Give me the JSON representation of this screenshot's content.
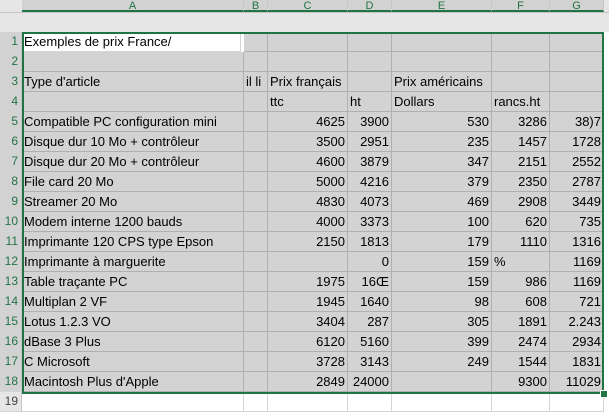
{
  "columns": [
    "A",
    "B",
    "C",
    "D",
    "E",
    "F",
    "G"
  ],
  "rows": [
    {
      "n": "1",
      "A": "Exemples de prix France/",
      "B": "",
      "C": "",
      "D": "",
      "E": "",
      "F": "",
      "G": ""
    },
    {
      "n": "2",
      "A": "",
      "B": "",
      "C": "",
      "D": "",
      "E": "",
      "F": "",
      "G": ""
    },
    {
      "n": "3",
      "A": "Type d'article",
      "B": "il li",
      "C": "Prix français",
      "D": "",
      "E": "Prix américains",
      "F": "",
      "G": ""
    },
    {
      "n": "4",
      "A": "",
      "B": "",
      "C": "ttc",
      "D": "ht",
      "E": "Dollars",
      "F": "rancs.ht",
      "G": ""
    },
    {
      "n": "5",
      "A": "Compatible PC configuration mini",
      "B": "",
      "C": "4625",
      "D": "3900",
      "E": "530",
      "F": "3286",
      "G": "38)7"
    },
    {
      "n": "6",
      "A": "Disque dur 10 Mo + contrôleur",
      "B": "",
      "C": "3500",
      "D": "2951",
      "E": "235",
      "F": "1457",
      "G": "1728"
    },
    {
      "n": "7",
      "A": "Disque dur 20 Mo + contrôleur",
      "B": "",
      "C": "4600",
      "D": "3879",
      "E": "347",
      "F": "2151",
      "G": "2552"
    },
    {
      "n": "8",
      "A": "File card 20 Mo",
      "B": "",
      "C": "5000",
      "D": "4216",
      "E": "379",
      "F": "2350",
      "G": "2787"
    },
    {
      "n": "9",
      "A": "Streamer 20 Mo",
      "B": "",
      "C": "4830",
      "D": "4073",
      "E": "469",
      "F": "2908",
      "G": "3449"
    },
    {
      "n": "10",
      "A": "Modem interne 1200 bauds",
      "B": "",
      "C": "4000",
      "D": "3373",
      "E": "100",
      "F": "620",
      "G": "735"
    },
    {
      "n": "11",
      "A": "Imprimante 120 CPS type Epson",
      "B": "",
      "C": "2150",
      "D": "1813",
      "E": "179",
      "F": "1110",
      "G": "1316"
    },
    {
      "n": "12",
      "A": "Imprimante à marguerite",
      "B": "",
      "C": "",
      "D": "0",
      "E": "159",
      "F": "%",
      "G": "1169"
    },
    {
      "n": "13",
      "A": "Table traçante PC",
      "B": "",
      "C": "1975",
      "D": "16Œ",
      "E": "159",
      "F": "986",
      "G": "1169"
    },
    {
      "n": "14",
      "A": "Multiplan 2 VF",
      "B": "",
      "C": "1945",
      "D": "1640",
      "E": "98",
      "F": "608",
      "G": "721"
    },
    {
      "n": "15",
      "A": "Lotus 1.2.3 VO",
      "B": "",
      "C": "3404",
      "D": "287",
      "E": "305",
      "F": "1891",
      "G": "2.243"
    },
    {
      "n": "16",
      "A": "dBase 3 Plus",
      "B": "",
      "C": "6120",
      "D": "5160",
      "E": "399",
      "F": "2474",
      "G": "2934"
    },
    {
      "n": "17",
      "A": "C Microsoft",
      "B": "",
      "C": "3728",
      "D": "3143",
      "E": "249",
      "F": "1544",
      "G": "1831"
    },
    {
      "n": "18",
      "A": "Macintosh Plus d'Apple",
      "B": "",
      "C": "2849",
      "D": "24000",
      "E": "",
      "F": "9300",
      "G": "11029"
    },
    {
      "n": "19",
      "A": "",
      "B": "",
      "C": "",
      "D": "",
      "E": "",
      "F": "",
      "G": ""
    }
  ],
  "colors": {
    "selection": "#217346",
    "shade": "#d3d3d3",
    "header": "#e6e6e6"
  }
}
